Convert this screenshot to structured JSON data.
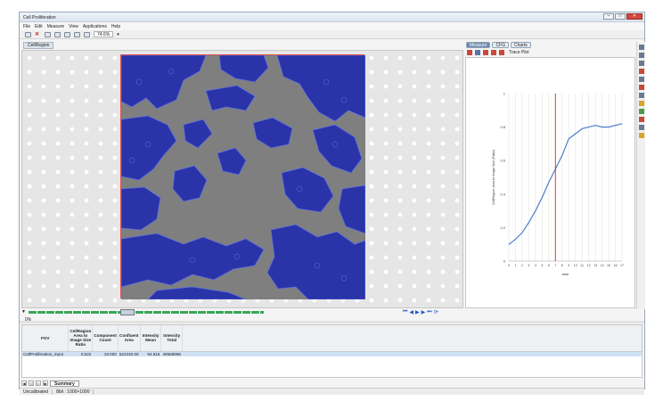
{
  "window": {
    "title": "Cell Proliferation"
  },
  "menu": [
    "File",
    "Edit",
    "Measure",
    "View",
    "Applications",
    "Help"
  ],
  "toolbar": {
    "zoom": "74.6%"
  },
  "document_tab": "CellRegion",
  "image": {
    "overlay_color": "#2a34a8",
    "background_color": "#808080",
    "timeline_position_fraction": 0.42
  },
  "progress": {
    "text": "0%"
  },
  "chart_tabs": [
    "Measure",
    "CFG",
    "Charts"
  ],
  "chart_toolbar": {
    "trace_label": "Trace Plot"
  },
  "chart_data": {
    "type": "line",
    "ylabel": "CellRegion: Area to Image Size (Ratio)",
    "xlabel": "time",
    "x": [
      0,
      1,
      2,
      3,
      4,
      5,
      6,
      7,
      8,
      9,
      10,
      11,
      12,
      13,
      14,
      15,
      16,
      17
    ],
    "xticks": [
      "0",
      "1",
      "2",
      "3",
      "4",
      "5",
      "6",
      "7",
      "8",
      "9",
      "10",
      "11",
      "12",
      "13",
      "14",
      "15",
      "16",
      "17"
    ],
    "yticks": [
      "0",
      "0.2",
      "0.4",
      "0.6",
      "0.8",
      "1"
    ],
    "ylim": [
      0,
      1
    ],
    "series": [
      {
        "values": [
          0.1,
          0.13,
          0.17,
          0.23,
          0.3,
          0.38,
          0.47,
          0.55,
          0.63,
          0.73,
          0.76,
          0.79,
          0.8,
          0.81,
          0.8,
          0.8,
          0.81,
          0.82
        ],
        "color": "#4c7dc9"
      }
    ],
    "marker_x": 7,
    "marker_color": "#e03a2a",
    "grid": "vertical"
  },
  "table": {
    "headers": [
      "FOV",
      "CellRegion Area to Image Size Ratio",
      "Component Count",
      "Confluent Area",
      "Intensity Mean",
      "Intensity Total"
    ],
    "rows": [
      {
        "fov": "CellProliferation_input",
        "ratio": "0.522",
        "count": "19.000",
        "area": "522240.00",
        "mean": "94.916",
        "total": "49568996"
      }
    ]
  },
  "sheet_tab": "Summary",
  "status": {
    "calibration": "Uncalibrated",
    "bits": "8bit : 1000×1000"
  }
}
